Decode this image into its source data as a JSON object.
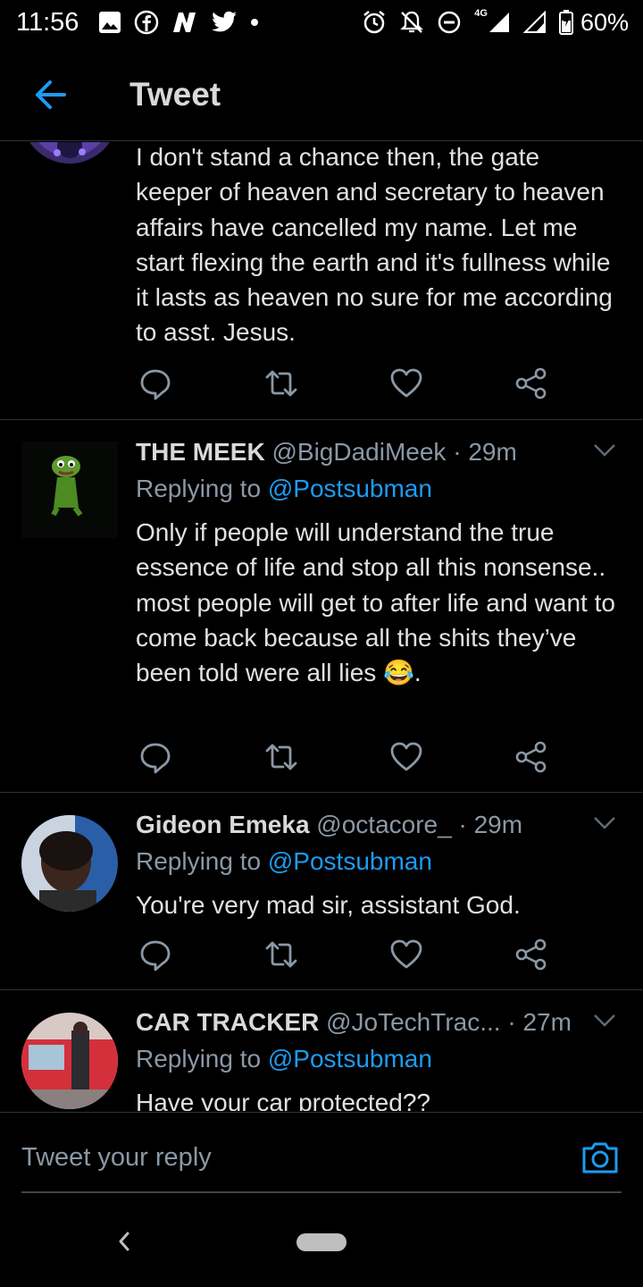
{
  "status_bar": {
    "time": "11:56",
    "battery": "60%",
    "network": "4G"
  },
  "header": {
    "title": "Tweet"
  },
  "tweets": [
    {
      "body": "I don't stand a chance then, the gate keeper of heaven and secretary to heaven affairs have cancelled my name. Let me start flexing the earth and it's fullness while it lasts as heaven no sure for me according to asst. Jesus."
    },
    {
      "name": "THE MEEK",
      "handle": "@BigDadiMeek",
      "separator": "·",
      "time": "29m",
      "replying_prefix": "Replying to",
      "replying_to": "@Postsubman",
      "body": "Only if people will understand the true essence of life and stop all this nonsense.. most people will get to after life and want to come back because all the shits they’ve been told were all lies 😂."
    },
    {
      "name": "Gideon Emeka",
      "handle": "@octacore_",
      "separator": "·",
      "time": "29m",
      "replying_prefix": "Replying to",
      "replying_to": "@Postsubman",
      "body": "You're very mad sir, assistant God."
    },
    {
      "name": "CAR TRACKER",
      "handle": "@JoTechTrac...",
      "separator": "·",
      "time": "27m",
      "replying_prefix": "Replying to",
      "replying_to": "@Postsubman",
      "body": "Have your car protected??"
    }
  ],
  "compose": {
    "placeholder": "Tweet your reply"
  },
  "colors": {
    "background": "#000000",
    "accent": "#1d9bf0",
    "muted": "#8b98a5",
    "divider": "#2f3336"
  },
  "icons": [
    "back-arrow-icon",
    "reply-icon",
    "retweet-icon",
    "like-icon",
    "share-icon",
    "camera-icon",
    "chevron-down-icon"
  ]
}
